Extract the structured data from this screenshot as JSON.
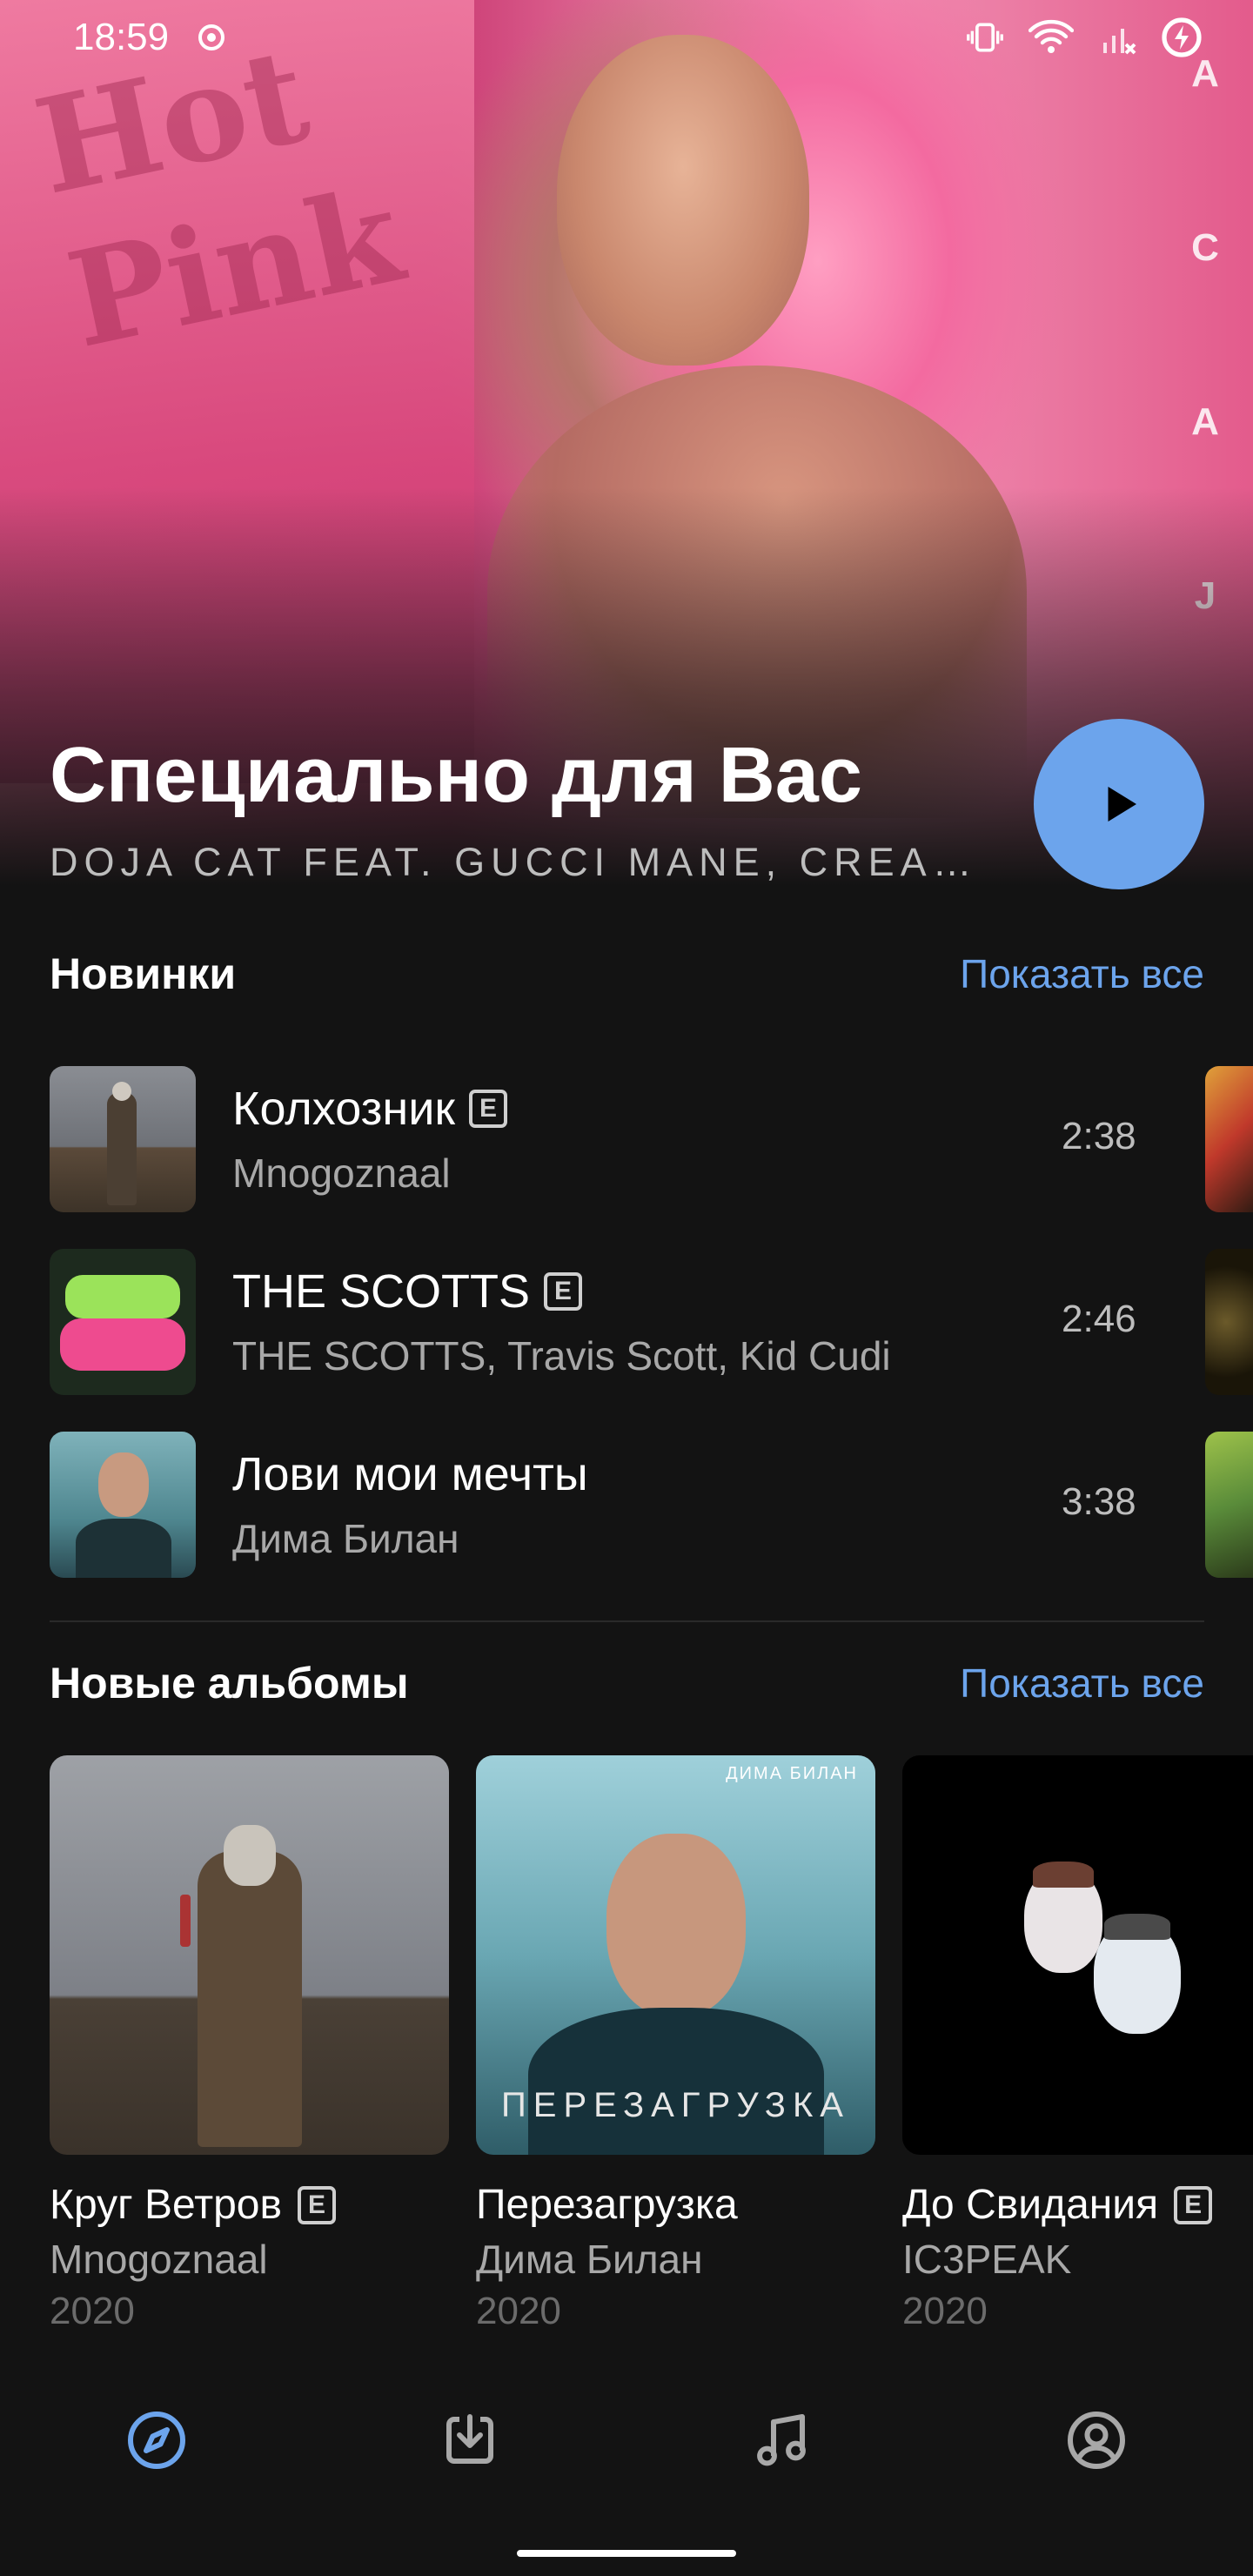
{
  "status_bar": {
    "time": "18:59",
    "icons": [
      "record-icon",
      "vibrate-icon",
      "wifi-icon",
      "signal-icon",
      "battery-saver-icon"
    ]
  },
  "hero": {
    "title": "Специально для Вас",
    "subtitle": "DOJA CAT FEAT. GUCCI MANE, CREA…",
    "cover_graffiti": "Hot Pink",
    "cover_side_letters": [
      "A",
      "C",
      "A",
      "J"
    ],
    "play_icon": "play-icon",
    "accent": "#6ca4ec"
  },
  "new_tracks": {
    "title": "Новинки",
    "show_all": "Показать все",
    "items": [
      {
        "title": "Колхозник",
        "explicit": true,
        "artist": "Mnogoznaal",
        "duration": "2:38"
      },
      {
        "title": "THE SCOTTS",
        "explicit": true,
        "artist": "THE SCOTTS, Travis Scott, Kid Cudi",
        "duration": "2:46"
      },
      {
        "title": "Лови мои мечты",
        "explicit": false,
        "artist": "Дима Билан",
        "duration": "3:38"
      }
    ],
    "explicit_badge": "E"
  },
  "new_albums": {
    "title": "Новые альбомы",
    "show_all": "Показать все",
    "items": [
      {
        "title": "Круг Ветров",
        "explicit": true,
        "artist": "Mnogoznaal",
        "year": "2020"
      },
      {
        "title": "Перезагрузка",
        "explicit": false,
        "artist": "Дима Билан",
        "year": "2020",
        "cover_text": "ПЕРЕЗАГРУЗКА",
        "cover_top_text": "ДИМА БИЛАН"
      },
      {
        "title": "До Свидания",
        "explicit": true,
        "artist": "IC3PEAK",
        "year": "2020"
      }
    ]
  },
  "bottom_nav": {
    "items": [
      "compass-icon",
      "download-icon",
      "music-note-icon",
      "profile-icon"
    ],
    "active": "compass-icon"
  }
}
